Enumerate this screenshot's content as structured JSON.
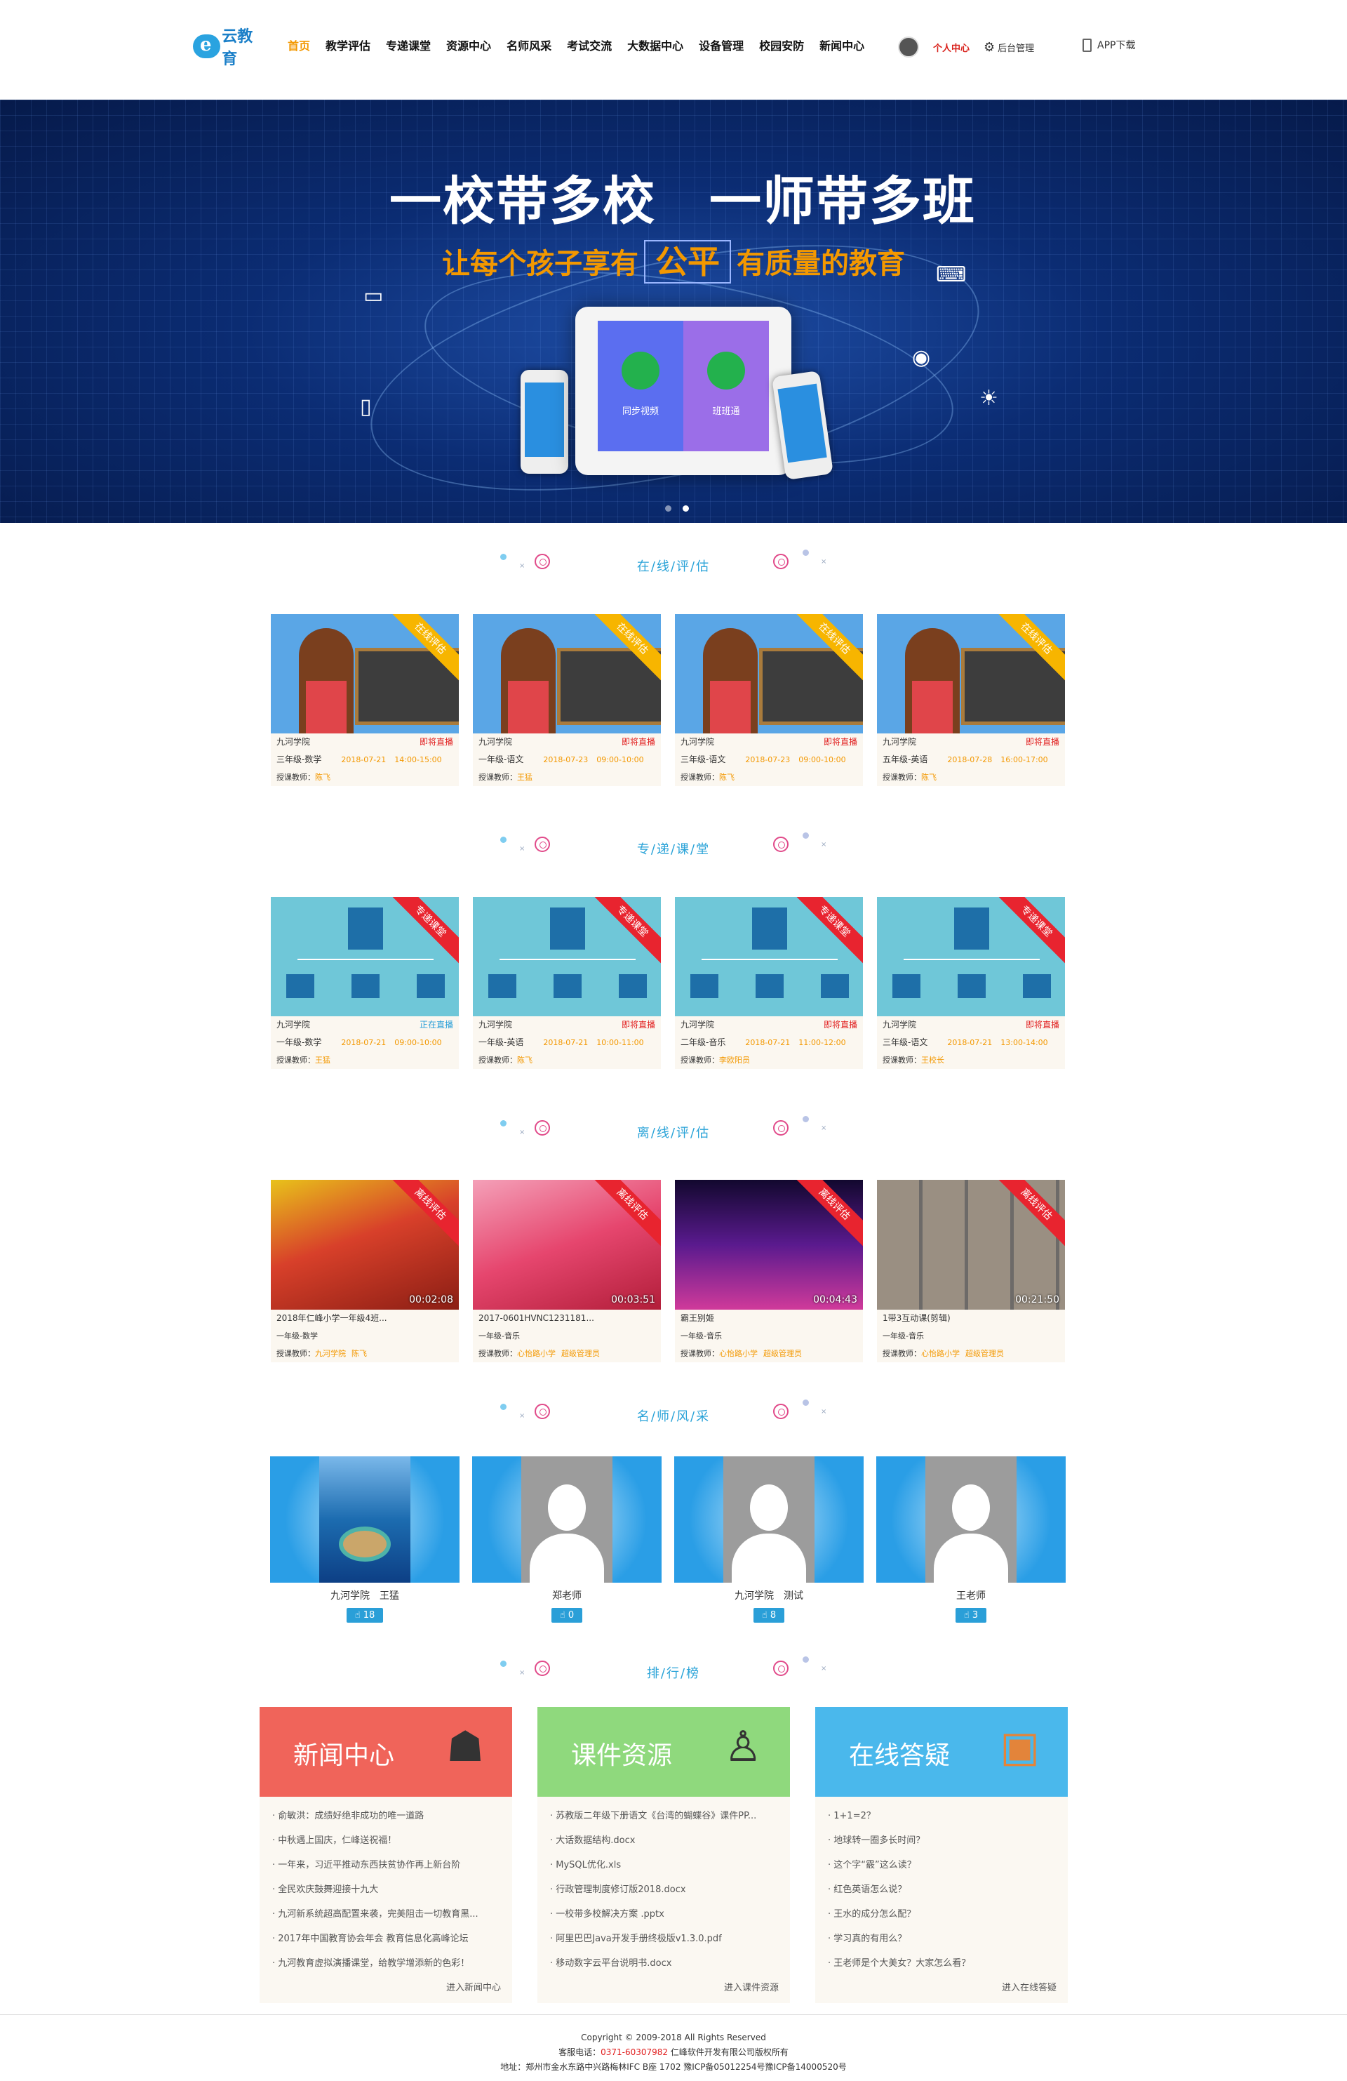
{
  "header": {
    "logo_text": "云教育",
    "nav": [
      "首页",
      "教学评估",
      "专递课堂",
      "资源中心",
      "名师风采",
      "考试交流",
      "大数据中心",
      "设备管理",
      "校园安防",
      "新闻中心"
    ],
    "user_center": "个人中心",
    "admin": "后台管理",
    "app_download": "APP下载"
  },
  "banner": {
    "title": "一校带多校　一师带多班",
    "subtitle_pre": "让每个孩子享有",
    "subtitle_hl": "公平",
    "subtitle_post": "有质量的教育",
    "tablet_left": "同步视频",
    "tablet_right": "班班通"
  },
  "sections": {
    "online": "在/线/评/估",
    "zhuandi": "专/递/课/堂",
    "offline": "离/线/评/估",
    "teachers": "名/师/风/采",
    "ranking": "排/行/榜"
  },
  "online_cards": [
    {
      "ribbon": "在线评估",
      "school": "九河学院",
      "status": "即将直播",
      "grade": "三年级-数学",
      "date": "2018-07-21",
      "time": "14:00-15:00",
      "teacher_label": "授课教师：",
      "teacher": "陈飞"
    },
    {
      "ribbon": "在线评估",
      "school": "九河学院",
      "status": "即将直播",
      "grade": "一年级-语文",
      "date": "2018-07-23",
      "time": "09:00-10:00",
      "teacher_label": "授课教师：",
      "teacher": "王猛"
    },
    {
      "ribbon": "在线评估",
      "school": "九河学院",
      "status": "即将直播",
      "grade": "三年级-语文",
      "date": "2018-07-23",
      "time": "09:00-10:00",
      "teacher_label": "授课教师：",
      "teacher": "陈飞"
    },
    {
      "ribbon": "在线评估",
      "school": "九河学院",
      "status": "即将直播",
      "grade": "五年级-英语",
      "date": "2018-07-28",
      "time": "16:00-17:00",
      "teacher_label": "授课教师：",
      "teacher": "陈飞"
    }
  ],
  "zhuandi_cards": [
    {
      "ribbon": "专递课堂",
      "school": "九河学院",
      "status": "正在直播",
      "grade": "一年级-数学",
      "date": "2018-07-21",
      "time": "09:00-10:00",
      "teacher_label": "授课教师：",
      "teacher": "王猛"
    },
    {
      "ribbon": "专递课堂",
      "school": "九河学院",
      "status": "即将直播",
      "grade": "一年级-英语",
      "date": "2018-07-21",
      "time": "10:00-11:00",
      "teacher_label": "授课教师：",
      "teacher": "陈飞"
    },
    {
      "ribbon": "专递课堂",
      "school": "九河学院",
      "status": "即将直播",
      "grade": "二年级-音乐",
      "date": "2018-07-21",
      "time": "11:00-12:00",
      "teacher_label": "授课教师：",
      "teacher": "李欧阳员"
    },
    {
      "ribbon": "专递课堂",
      "school": "九河学院",
      "status": "即将直播",
      "grade": "三年级-语文",
      "date": "2018-07-21",
      "time": "13:00-14:00",
      "teacher_label": "授课教师：",
      "teacher": "王校长"
    }
  ],
  "offline_cards": [
    {
      "ribbon": "离线评估",
      "title": "2018年仁峰小学一年级4班...",
      "duration": "00:02:08",
      "grade": "一年级-数学",
      "teacher_label": "授课教师：",
      "school": "九河学院",
      "teacher": "陈飞"
    },
    {
      "ribbon": "离线评估",
      "title": "2017-0601HVNC1231181...",
      "duration": "00:03:51",
      "grade": "一年级-音乐",
      "teacher_label": "授课教师：",
      "school": "心怡路小学",
      "teacher": "超级管理员"
    },
    {
      "ribbon": "离线评估",
      "title": "霸王别姬",
      "duration": "00:04:43",
      "grade": "一年级-音乐",
      "teacher_label": "授课教师：",
      "school": "心怡路小学",
      "teacher": "超级管理员"
    },
    {
      "ribbon": "离线评估",
      "title": "1带3互动课(剪辑)",
      "duration": "00:21:50",
      "grade": "一年级-音乐",
      "teacher_label": "授课教师：",
      "school": "心怡路小学",
      "teacher": "超级管理员"
    }
  ],
  "teachers": [
    {
      "name": "九河学院　王猛",
      "likes": "18"
    },
    {
      "name": "郑老师",
      "likes": "0"
    },
    {
      "name": "九河学院　测试",
      "likes": "8"
    },
    {
      "name": "王老师",
      "likes": "3"
    }
  ],
  "panels": [
    {
      "title": "新闻中心",
      "color": "#f0645a",
      "items": [
        "俞敏洪：成绩好绝非成功的唯一道路",
        "中秋遇上国庆，仁峰送祝福！",
        "一年来，习近平推动东西扶贫协作再上新台阶",
        "全民欢庆鼓舞迎接十九大",
        "九河新系统超高配置来袭，完美阻击一切教育黑...",
        "2017年中国教育协会年会 教育信息化高峰论坛",
        "九河教育虚拟演播课堂，给教学增添新的色彩！"
      ],
      "more": "进入新闻中心"
    },
    {
      "title": "课件资源",
      "color": "#8fd97d",
      "items": [
        "苏教版二年级下册语文《台湾的蝴蝶谷》课件PP...",
        "大话数据结构.docx",
        "MySQL优化.xls",
        "行政管理制度修订版2018.docx",
        "一校带多校解决方案 .pptx",
        "阿里巴巴Java开发手册终极版v1.3.0.pdf",
        "移动数字云平台说明书.docx"
      ],
      "more": "进入课件资源"
    },
    {
      "title": "在线答疑",
      "color": "#4ab8ec",
      "items": [
        "1+1=2？",
        "地球转一圈多长时间？",
        "这个字“霰”这么读？",
        "红色英语怎么说？",
        "王水的成分怎么配？",
        "学习真的有用么？",
        "王老师是个大美女？大家怎么看？"
      ],
      "more": "进入在线答疑"
    }
  ],
  "footer": {
    "copyright": "Copyright © 2009-2018 All Rights Reserved",
    "tel_label": "客服电话：",
    "tel": "0371-60307982",
    "company": "仁峰软件开发有限公司版权所有",
    "address": "地址：郑州市金水东路中兴路梅林IFC B座 1702  豫ICP备05012254号豫ICP备14000520号"
  }
}
